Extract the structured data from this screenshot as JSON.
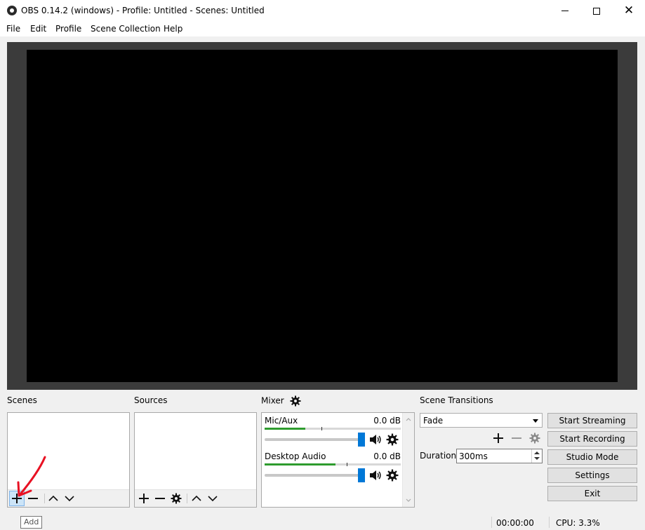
{
  "window": {
    "title": "OBS 0.14.2 (windows) - Profile: Untitled - Scenes: Untitled",
    "icon": "obs-logo-icon",
    "controls": [
      "minimize-icon",
      "maximize-icon",
      "close-icon"
    ]
  },
  "menu": {
    "items": [
      "File",
      "Edit",
      "Profile",
      "Scene Collection",
      "Help"
    ]
  },
  "docks": {
    "scenes": {
      "title": "Scenes",
      "toolbar": [
        "plus-icon",
        "minus-icon",
        "chevron-up-icon",
        "chevron-down-icon"
      ],
      "tooltip": "Add"
    },
    "sources": {
      "title": "Sources",
      "toolbar": [
        "plus-icon",
        "minus-icon",
        "gear-icon",
        "chevron-up-icon",
        "chevron-down-icon"
      ]
    },
    "mixer": {
      "title": "Mixer",
      "channels": [
        {
          "name": "Mic/Aux",
          "db": "0.0 dB",
          "level": 0.3
        },
        {
          "name": "Desktop Audio",
          "db": "0.0 dB",
          "level": 0.52
        }
      ]
    },
    "transitions": {
      "title": "Scene Transitions",
      "selected": "Fade",
      "duration_label": "Duration",
      "duration_value": "300ms"
    }
  },
  "controls": {
    "start_streaming": "Start Streaming",
    "start_recording": "Start Recording",
    "studio_mode": "Studio Mode",
    "settings": "Settings",
    "exit": "Exit"
  },
  "status": {
    "time": "00:00:00",
    "cpu": "CPU: 3.3%"
  },
  "colors": {
    "preview_bg": "#3b3b3b",
    "canvas": "#000000",
    "meter": "#2e9c2e",
    "fader_handle": "#0078d7",
    "annotation": "#e81123"
  }
}
